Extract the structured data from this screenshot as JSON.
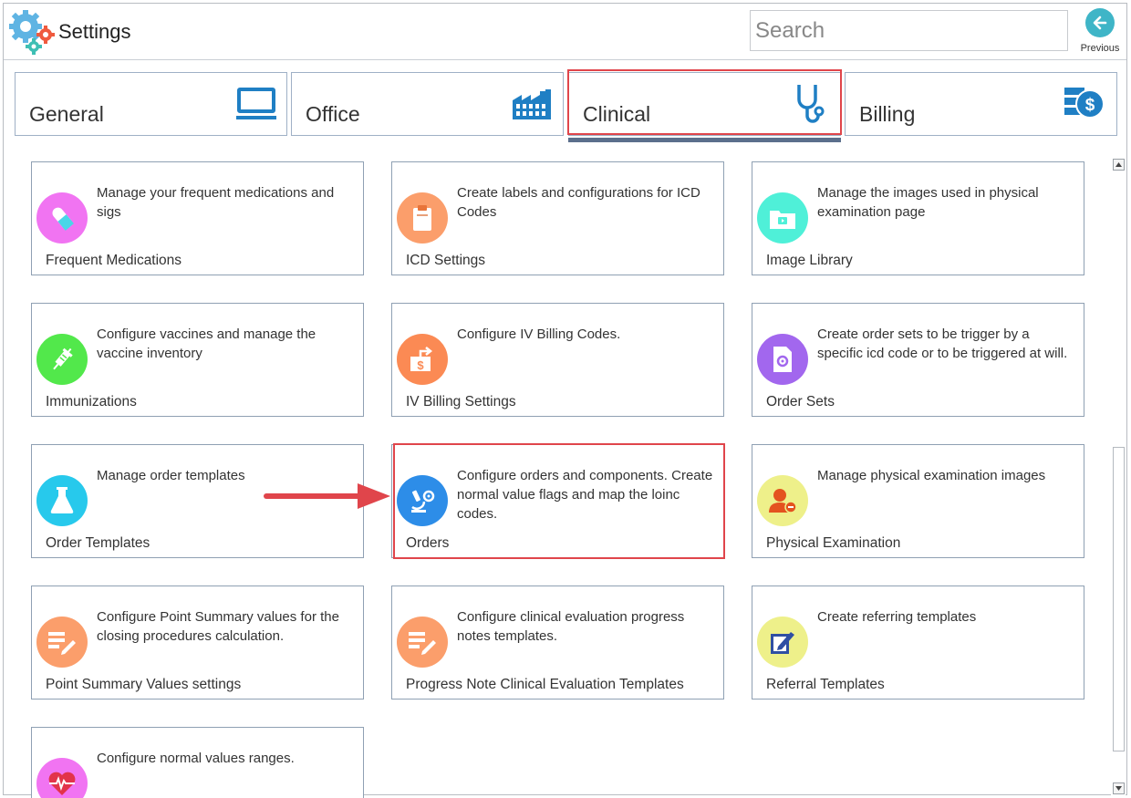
{
  "app": {
    "title": "Settings"
  },
  "search": {
    "placeholder": "Search",
    "value": ""
  },
  "previous": {
    "label": "Previous"
  },
  "tabs": [
    {
      "label": "General",
      "icon": "monitor-icon"
    },
    {
      "label": "Office",
      "icon": "factory-icon"
    },
    {
      "label": "Clinical",
      "icon": "stethoscope-icon",
      "active": true
    },
    {
      "label": "Billing",
      "icon": "billing-coin-icon"
    }
  ],
  "cards": [
    {
      "title": "Frequent Medications",
      "desc": "Manage your frequent medications and sigs",
      "icon": "pill-icon",
      "color": "#f174f2"
    },
    {
      "title": "ICD Settings",
      "desc": "Create labels and configurations for ICD Codes",
      "icon": "clipboard-icon",
      "color": "#fb9e6b"
    },
    {
      "title": "Image Library",
      "desc": "Manage the images used in physical examination page",
      "icon": "image-folder-icon",
      "color": "#4ff0d8"
    },
    {
      "title": "Immunizations",
      "desc": "Configure vaccines and manage the vaccine inventory",
      "icon": "syringe-icon",
      "color": "#52e84b"
    },
    {
      "title": "IV Billing Settings",
      "desc": "Configure IV Billing Codes.",
      "icon": "dollar-export-icon",
      "color": "#fb8a54"
    },
    {
      "title": "Order Sets",
      "desc": "Create order sets to be trigger by a specific icd code or to be triggered at will.",
      "icon": "gear-document-icon",
      "color": "#a267ee"
    },
    {
      "title": "Order Templates",
      "desc": "Manage order templates",
      "icon": "flask-icon",
      "color": "#27c9ec"
    },
    {
      "title": "Orders",
      "desc": "Configure orders and components. Create normal value flags and map the loinc codes.",
      "icon": "microscope-gear-icon",
      "color": "#2d8de8"
    },
    {
      "title": "Physical Examination",
      "desc": "Manage physical examination images",
      "icon": "user-badge-icon",
      "color": "#eef08a"
    },
    {
      "title": "Point Summary Values settings",
      "desc": "Configure Point Summary values for the closing procedures calculation.",
      "icon": "notes-edit-icon",
      "color": "#fb9e6b"
    },
    {
      "title": "Progress Note Clinical Evaluation Templates",
      "desc": "Configure clinical evaluation progress notes templates.",
      "icon": "notes-edit-icon",
      "color": "#fb9e6b"
    },
    {
      "title": "Referral Templates",
      "desc": "Create referring templates",
      "icon": "edit-document-icon",
      "color": "#eef08a"
    },
    {
      "title": "",
      "desc": "Configure normal values ranges.",
      "icon": "heart-pulse-icon",
      "color": "#f174f2"
    }
  ],
  "colors": {
    "accent": "#3fb5c7",
    "highlight": "#e0454b",
    "tab_icon": "#1f7fc4"
  }
}
